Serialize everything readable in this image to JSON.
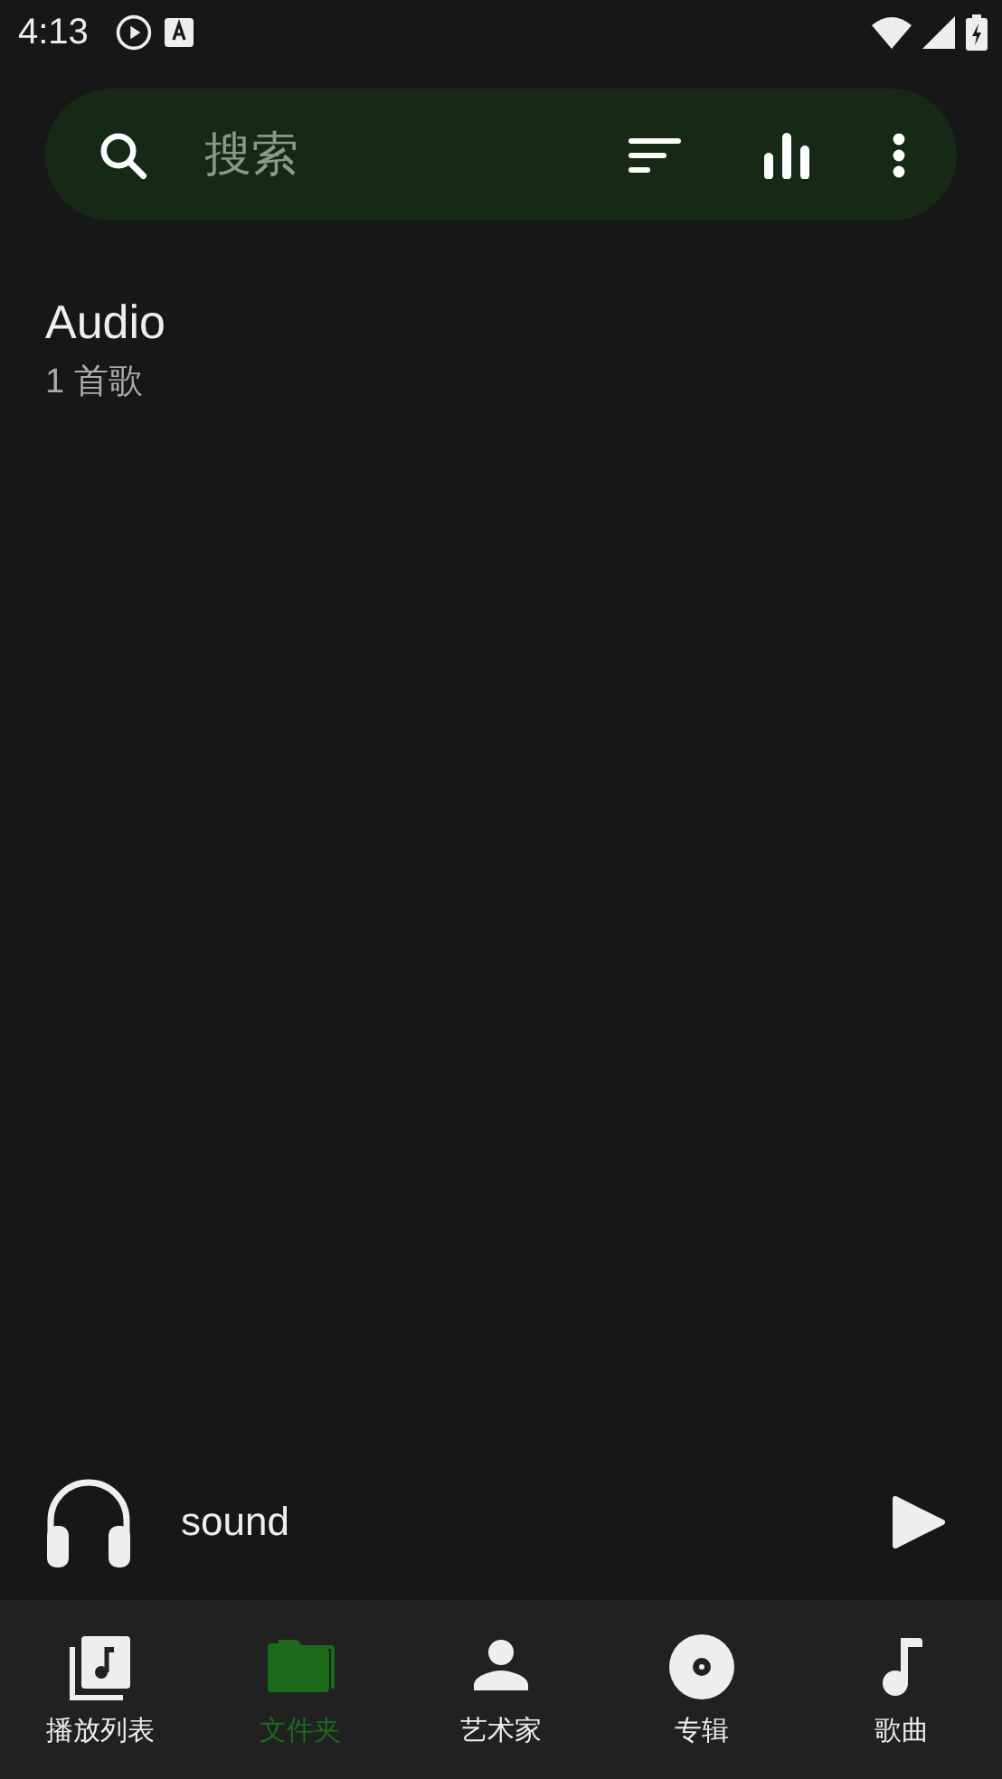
{
  "status_bar": {
    "time": "4:13"
  },
  "search": {
    "placeholder": "搜索"
  },
  "folders": [
    {
      "name": "Audio",
      "count": "1 首歌"
    }
  ],
  "now_playing": {
    "title": "sound",
    "playing": false
  },
  "tabs": [
    {
      "kind": "playlist",
      "label": "播放列表",
      "selected": false
    },
    {
      "kind": "folder",
      "label": "文件夹",
      "selected": true
    },
    {
      "kind": "artist",
      "label": "艺术家",
      "selected": false
    },
    {
      "kind": "album",
      "label": "专辑",
      "selected": false
    },
    {
      "kind": "song",
      "label": "歌曲",
      "selected": false
    }
  ]
}
